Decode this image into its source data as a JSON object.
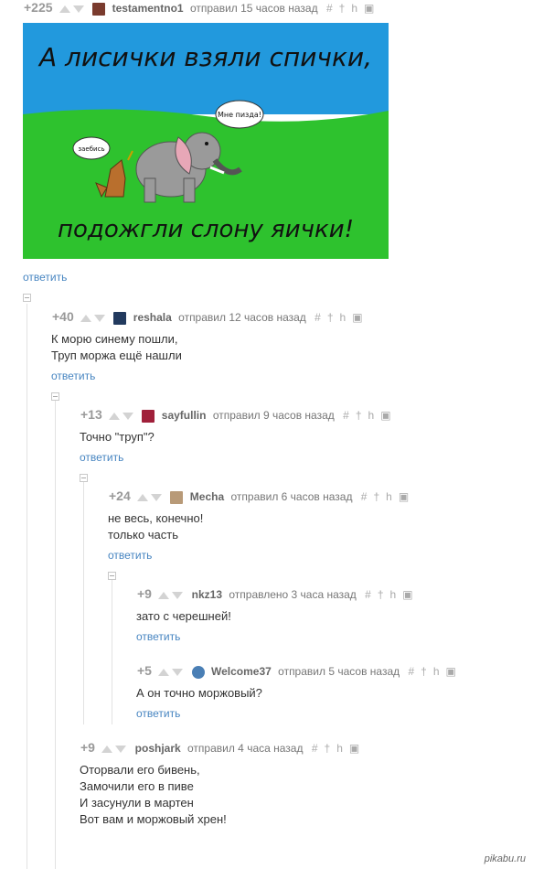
{
  "comments": [
    {
      "rating": "+225",
      "author": "testamentno1",
      "time": "отправил 15 часов назад",
      "reply": "ответить",
      "avatar_color": "#7a3b2e"
    },
    {
      "rating": "+40",
      "author": "reshala",
      "time": "отправил 12 часов назад",
      "text": [
        "К морю синему пошли,",
        "Труп моржа ещё нашли"
      ],
      "reply": "ответить",
      "avatar_color": "#223a5e"
    },
    {
      "rating": "+13",
      "author": "sayfullin",
      "time": "отправил 9 часов назад",
      "text": [
        "Точно \"труп\"?"
      ],
      "reply": "ответить",
      "avatar_color": "#a0203a"
    },
    {
      "rating": "+24",
      "author": "Mecha",
      "time": "отправил 6 часов назад",
      "text": [
        "не весь, конечно!",
        "только часть"
      ],
      "reply": "ответить",
      "avatar_color": "#b89a78"
    },
    {
      "rating": "+9",
      "author": "nkz13",
      "time": "отправлено 3 часа назад",
      "text": [
        "зато с черешней!"
      ],
      "reply": "ответить"
    },
    {
      "rating": "+5",
      "author": "Welcome37",
      "time": "отправил 5 часов назад",
      "text": [
        "А он точно моржовый?"
      ],
      "reply": "ответить",
      "avatar_color": "#4a7fb5"
    },
    {
      "rating": "+9",
      "author": "poshjark",
      "time": "отправил 4 часа назад",
      "text": [
        "Оторвали его бивень,",
        "Замочили его в пиве",
        "И засунули в мартен",
        "Вот вам и моржовый хрен!"
      ]
    }
  ],
  "picture": {
    "top_caption": "А лисички взяли спички,",
    "bottom_caption": "подожгли слону яички!",
    "fox_bubble": "заебись",
    "elephant_bubble": "Мне пизда!",
    "sky_color": "#2299dd",
    "grass_color": "#2ec22e"
  },
  "watermark": "pikabu.ru",
  "link_color": "#4785c1"
}
